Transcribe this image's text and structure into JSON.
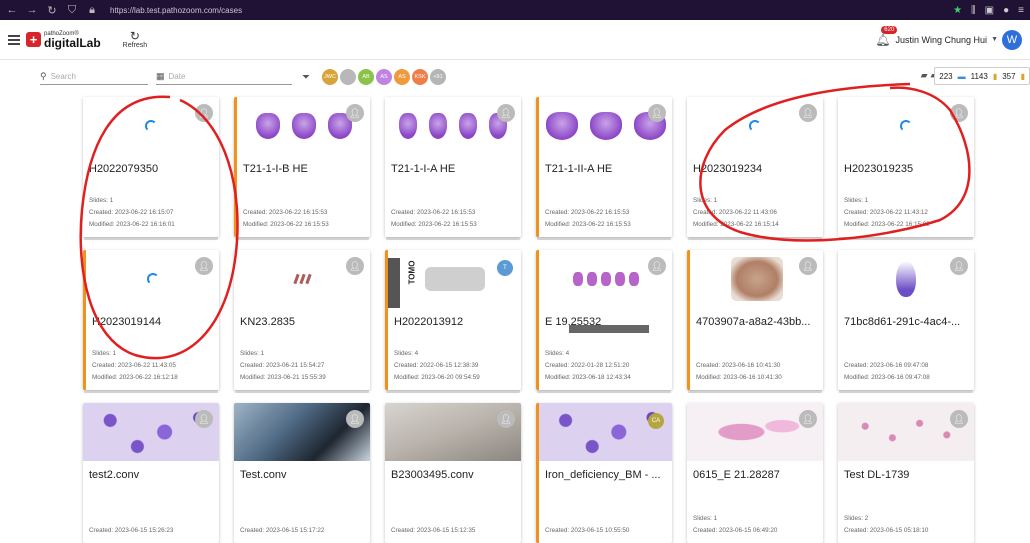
{
  "browser": {
    "url": "https://lab.test.pathozoom.com/cases"
  },
  "app": {
    "logo_small": "pathoZoom®",
    "logo_big": "digitalLab",
    "refresh_label": "Refresh",
    "notification_count": "620",
    "user_name": "Justin Wing Chung Hui",
    "user_avatar_letter": "W"
  },
  "filters": {
    "search_placeholder": "Search",
    "date_placeholder": "Date",
    "user_chips": [
      {
        "label": "JWC",
        "color": "#d8a43a"
      },
      {
        "label": "",
        "color": "#b8b8b8"
      },
      {
        "label": "AB",
        "color": "#8bc34a"
      },
      {
        "label": "AS",
        "color": "#c084e0"
      },
      {
        "label": "AS",
        "color": "#f09a3e"
      },
      {
        "label": "KSK",
        "color": "#ef7d4a"
      },
      {
        "label": "+91",
        "color": "#b5b5b5"
      }
    ]
  },
  "counts": {
    "cases": "223",
    "slides": "1143",
    "other": "357"
  },
  "cards": [
    {
      "title": "H2022079350",
      "slides": "Slides: 1",
      "created": "Created: 2023-06-22 16:15:07",
      "modified": "Modified: 2023-06-22 16:16:01",
      "thumb": "spinner",
      "orange": false
    },
    {
      "title": "T21-1-I-B HE",
      "slides": "",
      "created": "Created: 2023-06-22 16:15:53",
      "modified": "Modified: 2023-06-22 16:15:53",
      "thumb": "blobs3",
      "orange": true
    },
    {
      "title": "T21-1-I-A HE",
      "slides": "",
      "created": "Created: 2023-06-22 16:15:53",
      "modified": "Modified: 2023-06-22 16:15:53",
      "thumb": "blobs4",
      "orange": false
    },
    {
      "title": "T21-1-II-A HE",
      "slides": "",
      "created": "Created: 2023-06-22 16:15:53",
      "modified": "Modified: 2023-06-22 16:15:53",
      "thumb": "blobs3wide",
      "orange": true
    },
    {
      "title": "H2023019234",
      "slides": "Slides: 1",
      "created": "Created: 2023-06-22 11:43:06",
      "modified": "Modified: 2023-06-22 16:15:14",
      "thumb": "spinner",
      "orange": false
    },
    {
      "title": "H2023019235",
      "slides": "Slides: 1",
      "created": "Created: 2023-06-22 11:43:12",
      "modified": "Modified: 2023-06-22 16:15:02",
      "thumb": "spinner",
      "orange": false
    },
    {
      "title": "H2023019144",
      "slides": "Slides: 1",
      "created": "Created: 2023-06-22 11:43:05",
      "modified": "Modified: 2023-06-22 16:12:18",
      "thumb": "spinner",
      "orange": true
    },
    {
      "title": "KN23.2835",
      "slides": "Slides: 1",
      "created": "Created: 2023-06-21 15:54:27",
      "modified": "Modified: 2023-06-21 15:55:39",
      "thumb": "marks",
      "orange": false
    },
    {
      "title": "H2022013912",
      "slides": "Slides: 4",
      "created": "Created: 2022-06-15 12:38:39",
      "modified": "Modified: 2023-06-20 09:54:59",
      "thumb": "tomo",
      "orange": true,
      "badge": {
        "label": "T",
        "color": "#5b9bd5"
      }
    },
    {
      "title": "E 19.25532",
      "slides": "Slides: 4",
      "created": "Created: 2022-01-28 12:51:20",
      "modified": "Modified: 2023-06-18 12:43:34",
      "thumb": "hbars",
      "orange": true
    },
    {
      "title": "4703907a-a8a2-43bb...",
      "slides": "",
      "created": "Created: 2023-06-16 10:41:30",
      "modified": "Modified: 2023-06-16 10:41:30",
      "thumb": "tissue",
      "orange": true
    },
    {
      "title": "71bc8d61-291c-4ac4-...",
      "slides": "",
      "created": "Created: 2023-06-16 09:47:08",
      "modified": "Modified: 2023-06-16 09:47:08",
      "thumb": "drop",
      "orange": false
    },
    {
      "title": "test2.conv",
      "slides": "",
      "created": "Created: 2023-06-15 15:26:23",
      "modified": "",
      "thumb": "purple",
      "orange": false
    },
    {
      "title": "Test.conv",
      "slides": "",
      "created": "Created: 2023-06-15 15:17:22",
      "modified": "",
      "thumb": "photo-dark",
      "orange": false
    },
    {
      "title": "B23003495.conv",
      "slides": "",
      "created": "Created: 2023-06-15 15:12:35",
      "modified": "",
      "thumb": "photo-desk",
      "orange": false
    },
    {
      "title": "Iron_deficiency_BM - ...",
      "slides": "",
      "created": "Created: 2023-06-15 10:55:50",
      "modified": "",
      "thumb": "purple",
      "orange": true,
      "badge": {
        "label": "CA",
        "color": "#b5a642"
      }
    },
    {
      "title": "0615_E 21.28287",
      "slides": "Slides: 1",
      "created": "Created: 2023-06-15 06:49:20",
      "modified": "",
      "thumb": "pink",
      "orange": false
    },
    {
      "title": "Test DL-1739",
      "slides": "Slides: 2",
      "created": "Created: 2023-06-15 05:18:10",
      "modified": "",
      "thumb": "dots",
      "orange": false
    }
  ]
}
